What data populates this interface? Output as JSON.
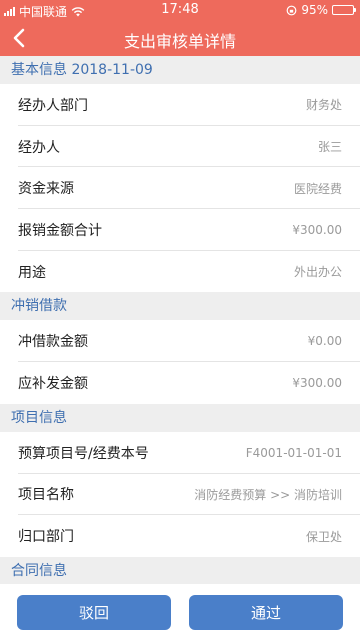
{
  "status_bar": {
    "carrier": "中国联通",
    "time": "17:48",
    "battery_percent": "95%",
    "battery_level": 0.95
  },
  "header": {
    "title": "支出审核单详情",
    "back_icon": "chevron-left-icon"
  },
  "sections": {
    "basic": {
      "title": "基本信息 2018-11-09",
      "rows": [
        {
          "label": "经办人部门",
          "value": "财务处"
        },
        {
          "label": "经办人",
          "value": "张三"
        },
        {
          "label": "资金来源",
          "value": "医院经费"
        },
        {
          "label": "报销金额合计",
          "value": "¥300.00"
        },
        {
          "label": "用途",
          "value": "外出办公"
        }
      ]
    },
    "loan": {
      "title": "冲销借款",
      "rows": [
        {
          "label": "冲借款金额",
          "value": "¥0.00"
        },
        {
          "label": "应补发金额",
          "value": "¥300.00"
        }
      ]
    },
    "project": {
      "title": "项目信息",
      "rows": [
        {
          "label": "预算项目号/经费本号",
          "value": "F4001-01-01-01"
        },
        {
          "label": "项目名称",
          "value": "消防经费预算 >> 消防培训"
        },
        {
          "label": "归口部门",
          "value": "保卫处"
        }
      ]
    },
    "contract": {
      "title": "合同信息"
    }
  },
  "footer": {
    "reject_label": "驳回",
    "approve_label": "通过"
  },
  "colors": {
    "header_bg": "#ee6a5c",
    "section_text": "#3f6fb0",
    "button_bg": "#4a7fc9"
  }
}
